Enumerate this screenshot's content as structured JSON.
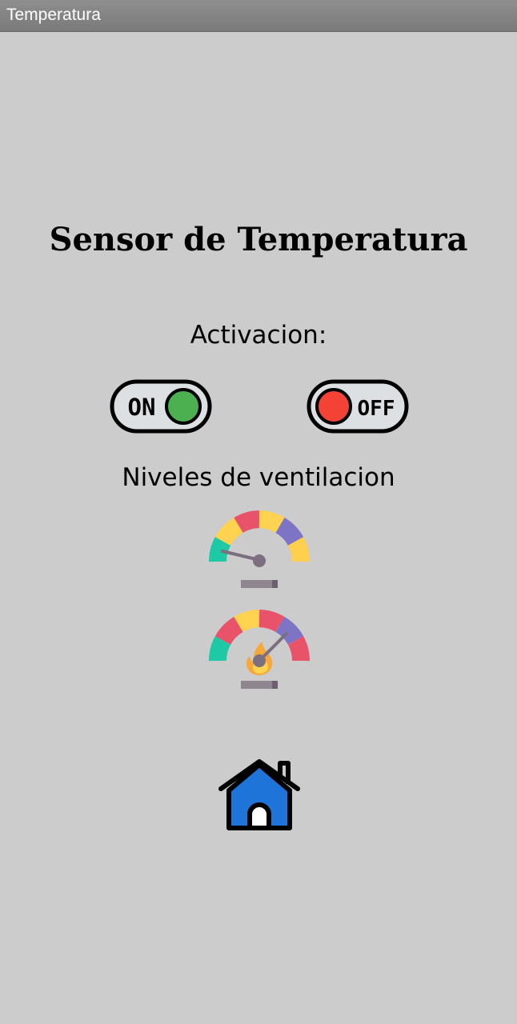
{
  "window": {
    "title": "Temperatura"
  },
  "main": {
    "heading": "Sensor de Temperatura",
    "activation_label": "Activacion:",
    "levels_label": "Niveles de ventilacion",
    "on_button": {
      "label": "ON",
      "icon": "toggle-on-icon",
      "color": "#4caf50"
    },
    "off_button": {
      "label": "OFF",
      "icon": "toggle-off-icon",
      "color": "#f44336"
    },
    "level_buttons": [
      {
        "icon": "gauge-low-icon"
      },
      {
        "icon": "gauge-high-fire-icon"
      }
    ],
    "home_button": {
      "icon": "home-icon",
      "color": "#1e74d8"
    }
  }
}
